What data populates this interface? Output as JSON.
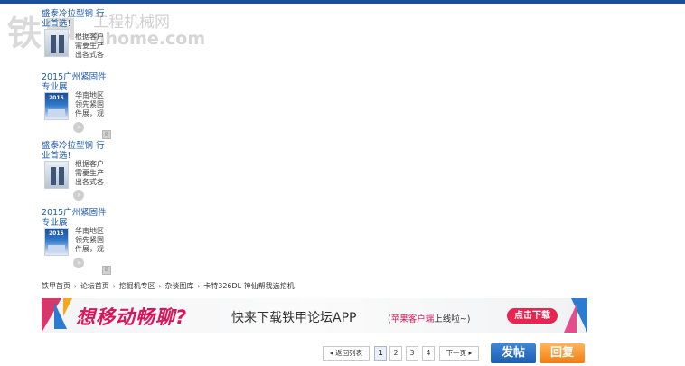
{
  "watermark": {
    "big": "铁甲",
    "small": "工程机械网",
    "domain": "hhome.com"
  },
  "sidebar_ads": [
    {
      "title": "盛泰冷拉型钢 行业首选!",
      "desc": [
        "根据客户",
        "需要生产",
        "出各式各"
      ],
      "arrow": "›",
      "mark": ""
    },
    {
      "title": "2015广州紧固件专业展",
      "desc": [
        "华南地区",
        "领先紧固",
        "件展，观"
      ],
      "arrow": "›",
      "mark": "⊘"
    },
    {
      "title": "盛泰冷拉型钢 行业首选!",
      "desc": [
        "根据客户",
        "需要生产",
        "出各式各"
      ],
      "arrow": "›",
      "mark": ""
    },
    {
      "title": "2015广州紧固件专业展",
      "desc": [
        "华南地区",
        "领先紧固",
        "件展，观"
      ],
      "arrow": "›",
      "mark": "⊘"
    }
  ],
  "breadcrumb": {
    "items": [
      "铁甲首页",
      "论坛首页",
      "挖掘机专区",
      "杂谈图库",
      "卡特326DL 神仙帮我选挖机"
    ],
    "separator": "›"
  },
  "banner": {
    "headline": "想移动畅聊?",
    "subtitle": "快来下载铁甲论坛APP",
    "note_open": "(",
    "note_highlight": "苹果客户端",
    "note_rest": "上线啦~",
    "note_close": ")",
    "button": "点击下载"
  },
  "pagination": {
    "back": "◂ 返回列表",
    "pages": [
      "1",
      "2",
      "3",
      "4"
    ],
    "current": "1",
    "next": "下一页 ▸"
  },
  "actions": {
    "post": "发帖",
    "reply": "回复"
  },
  "colors": {
    "brand": "#1a4f9c",
    "link": "#1e5ba8",
    "post": "#1c5eb2",
    "reply": "#f07d12",
    "banner_accent": "#d8175a"
  }
}
